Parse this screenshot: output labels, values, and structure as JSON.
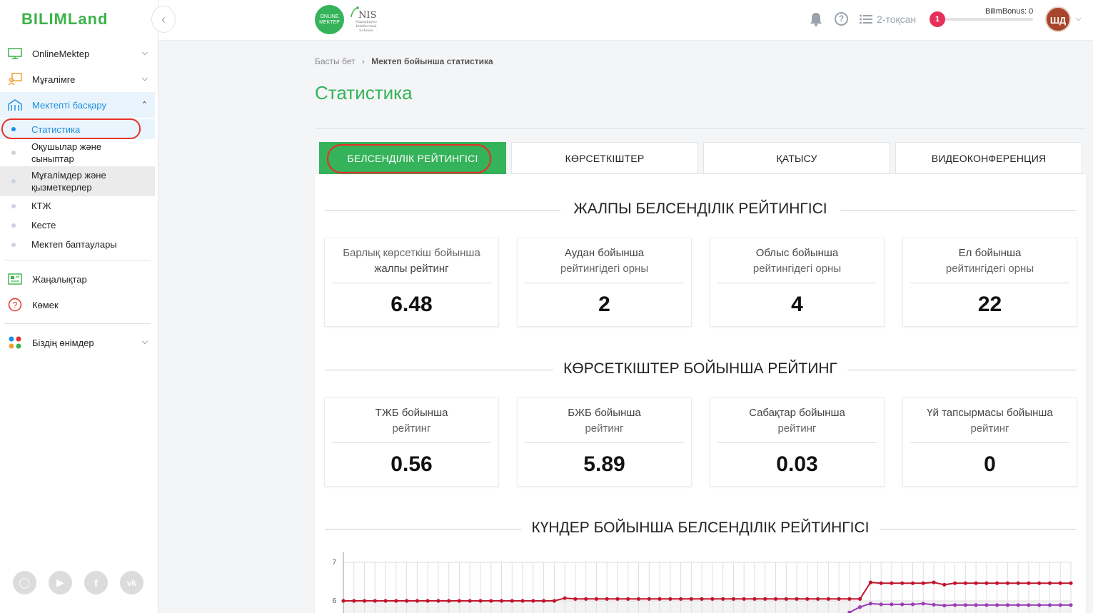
{
  "brand": {
    "logo_text": "BILIMLand",
    "collapse_icon": "chevron-left-icon"
  },
  "sidebar": {
    "items": [
      {
        "label": "OnlineMektep",
        "icon": "monitor-icon",
        "has_chevron": true
      },
      {
        "label": "Мұғалімге",
        "icon": "teacher-icon",
        "has_chevron": true
      },
      {
        "label": "Мектепті басқару",
        "icon": "school-building-icon",
        "has_chevron": true,
        "active": true
      }
    ],
    "subitems": [
      {
        "label": "Статистика",
        "active": true
      },
      {
        "label": "Оқушылар және сыныптар"
      },
      {
        "label": "Мұғалімдер және қызметкерлер",
        "highlighted": true
      },
      {
        "label": "КТЖ"
      },
      {
        "label": "Кесте"
      },
      {
        "label": "Мектеп баптаулары"
      }
    ],
    "items2": [
      {
        "label": "Жаңалықтар",
        "icon": "news-icon"
      },
      {
        "label": "Көмек",
        "icon": "help-circle-icon"
      }
    ],
    "products": {
      "label": "Біздің өнімдер",
      "icon": "apps-dots-icon"
    },
    "social": [
      "instagram-icon",
      "youtube-icon",
      "facebook-icon",
      "vk-icon"
    ]
  },
  "header": {
    "online_mektep_logo": "ONLINE MEKTEP",
    "nis_logo": "NIS",
    "nis_sub": "Nazarbayev Intellectual Schools",
    "quarter": "2-тоқсан",
    "level": "1",
    "bonus_label": "BilimBonus: 0",
    "bonus_progress": 0,
    "avatar_initials": "ШД"
  },
  "breadcrumb": {
    "home": "Басты бет",
    "current": "Мектеп бойынша статистика"
  },
  "page_title": "Статистика",
  "tabs": [
    {
      "label": "БЕЛСЕНДІЛІК РЕЙТИНГІСІ",
      "active": true
    },
    {
      "label": "КӨРСЕТКІШТЕР"
    },
    {
      "label": "ҚАТЫСУ"
    },
    {
      "label": "ВИДЕОКОНФЕРЕНЦИЯ"
    }
  ],
  "sections": {
    "overall_title": "ЖАЛПЫ БЕЛСЕНДІЛІК РЕЙТИНГІСІ",
    "indicators_title": "КӨРСЕТКІШТЕР БОЙЫНША РЕЙТИНГ",
    "daily_title": "КҮНДЕР БОЙЫНША БЕЛСЕНДІЛІК РЕЙТИНГІСІ"
  },
  "overall_cards": [
    {
      "line1": "Барлық көрсеткіш бойынша",
      "line2": "жалпы рейтинг",
      "value": "6.48"
    },
    {
      "line1": "Аудан бойынша",
      "line2": "рейтингідегі орны",
      "value": "2"
    },
    {
      "line1": "Облыс бойынша",
      "line2": "рейтингідегі орны",
      "value": "4"
    },
    {
      "line1": "Ел бойынша",
      "line2": "рейтингідегі орны",
      "value": "22"
    }
  ],
  "indicator_cards": [
    {
      "line1": "ТЖБ бойынша",
      "line2": "рейтинг",
      "value": "0.56"
    },
    {
      "line1": "БЖБ бойынша",
      "line2": "рейтинг",
      "value": "5.89"
    },
    {
      "line1": "Сабақтар бойынша",
      "line2": "рейтинг",
      "value": "0.03"
    },
    {
      "line1": "Үй тапсырмасы бойынша",
      "line2": "рейтинг",
      "value": "0"
    }
  ],
  "chart_data": {
    "type": "line",
    "title": "КҮНДЕР БОЙЫНША БЕЛСЕНДІЛІК РЕЙТИНГІСІ",
    "y_ticks": [
      "7",
      "6"
    ],
    "ylim": [
      5.5,
      7
    ],
    "series": [
      {
        "color": "#c0142b",
        "values": [
          6.0,
          6.0,
          6.0,
          6.0,
          6.0,
          6.0,
          6.0,
          6.0,
          6.0,
          6.0,
          6.0,
          6.0,
          6.0,
          6.0,
          6.0,
          6.0,
          6.0,
          6.0,
          6.0,
          6.0,
          6.0,
          6.07,
          6.05,
          6.05,
          6.05,
          6.05,
          6.05,
          6.05,
          6.05,
          6.05,
          6.05,
          6.05,
          6.05,
          6.05,
          6.05,
          6.05,
          6.05,
          6.05,
          6.05,
          6.05,
          6.05,
          6.05,
          6.05,
          6.05,
          6.05,
          6.05,
          6.05,
          6.05,
          6.05,
          6.05,
          6.48,
          6.46,
          6.46,
          6.46,
          6.46,
          6.46,
          6.48,
          6.42,
          6.46,
          6.46,
          6.46,
          6.46,
          6.46,
          6.46,
          6.46,
          6.46,
          6.46,
          6.46,
          6.46,
          6.46
        ]
      },
      {
        "color": "#9b3db8",
        "values": [
          null,
          null,
          null,
          null,
          null,
          null,
          null,
          null,
          null,
          null,
          null,
          null,
          null,
          null,
          null,
          null,
          null,
          null,
          null,
          null,
          null,
          null,
          null,
          null,
          null,
          null,
          null,
          null,
          null,
          null,
          null,
          null,
          null,
          null,
          null,
          null,
          null,
          null,
          null,
          null,
          null,
          null,
          null,
          null,
          null,
          null,
          null,
          null,
          5.7,
          5.84,
          5.93,
          5.91,
          5.91,
          5.91,
          5.91,
          5.93,
          5.9,
          5.88,
          5.89,
          5.89,
          5.89,
          5.89,
          5.89,
          5.89,
          5.89,
          5.89,
          5.89,
          5.89,
          5.89,
          5.89
        ]
      }
    ],
    "grid": true
  }
}
